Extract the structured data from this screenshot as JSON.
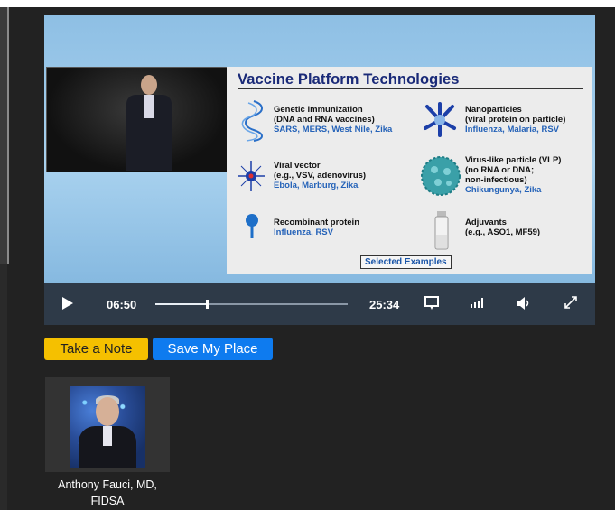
{
  "slide": {
    "title": "Vaccine Platform Technologies",
    "items": [
      {
        "name": "Genetic immunization",
        "detail": "(DNA and RNA vaccines)",
        "examples": "SARS, MERS, West Nile, Zika",
        "icon": "dna-icon"
      },
      {
        "name": "Nanoparticles",
        "detail": "(viral protein on particle)",
        "examples": "Influenza, Malaria, RSV",
        "icon": "nanoparticle-icon"
      },
      {
        "name": "Viral vector",
        "detail": "(e.g., VSV, adenovirus)",
        "examples": "Ebola, Marburg, Zika",
        "icon": "viral-vector-icon"
      },
      {
        "name": "Virus-like particle (VLP)",
        "detail": "(no RNA or DNA;",
        "detail2": "non-infectious)",
        "examples": "Chikungunya, Zika",
        "icon": "vlp-icon"
      },
      {
        "name": "Recombinant protein",
        "detail": "",
        "examples": "Influenza, RSV",
        "icon": "protein-icon"
      },
      {
        "name": "Adjuvants",
        "detail": "(e.g., ASO1, MF59)",
        "examples": "",
        "icon": "vial-icon"
      }
    ],
    "footer": "Selected Examples"
  },
  "player": {
    "current_time": "06:50",
    "duration": "25:34",
    "progress": 0.267
  },
  "actions": {
    "take_note": "Take a Note",
    "save_place": "Save My Place"
  },
  "speaker": {
    "name": "Anthony Fauci, MD,",
    "credentials": "FIDSA"
  },
  "colors": {
    "accent_yellow": "#f5c000",
    "accent_blue": "#0e7bef",
    "slide_title": "#1a2a78",
    "example_text": "#2462b8"
  }
}
